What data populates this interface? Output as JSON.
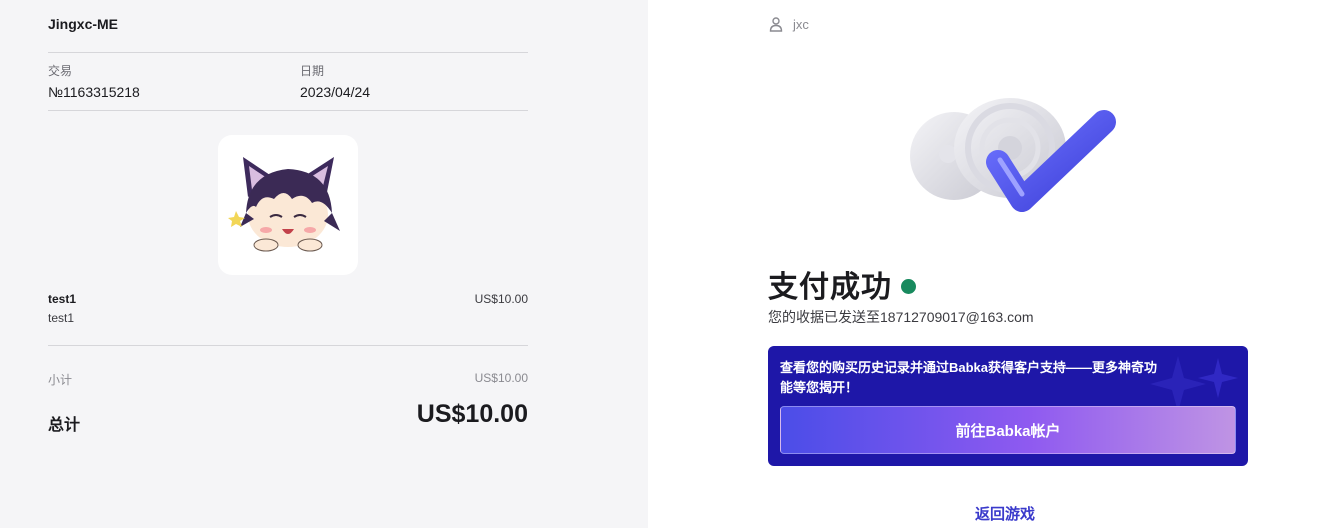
{
  "receipt": {
    "merchant": "Jingxc-ME",
    "transaction_label": "交易",
    "transaction_value": "№1163315218",
    "date_label": "日期",
    "date_value": "2023/04/24",
    "item": {
      "title": "test1",
      "subtitle": "test1",
      "price": "US$10.00"
    },
    "subtotal_label": "小计",
    "subtotal_value": "US$10.00",
    "total_label": "总计",
    "total_value": "US$10.00"
  },
  "account": {
    "username": "jxc",
    "icon": "user-icon"
  },
  "success": {
    "title": "支付成功",
    "status_color": "#188a5e",
    "receipt_sent": "您的收据已发送至18712709017@163.com"
  },
  "promo": {
    "text": "查看您的购买历史记录并通过Babka获得客户支持——更多神奇功能等您揭开！",
    "button_label": "前往Babka帐户",
    "background": "#1e17a8"
  },
  "back_link": "返回游戏"
}
